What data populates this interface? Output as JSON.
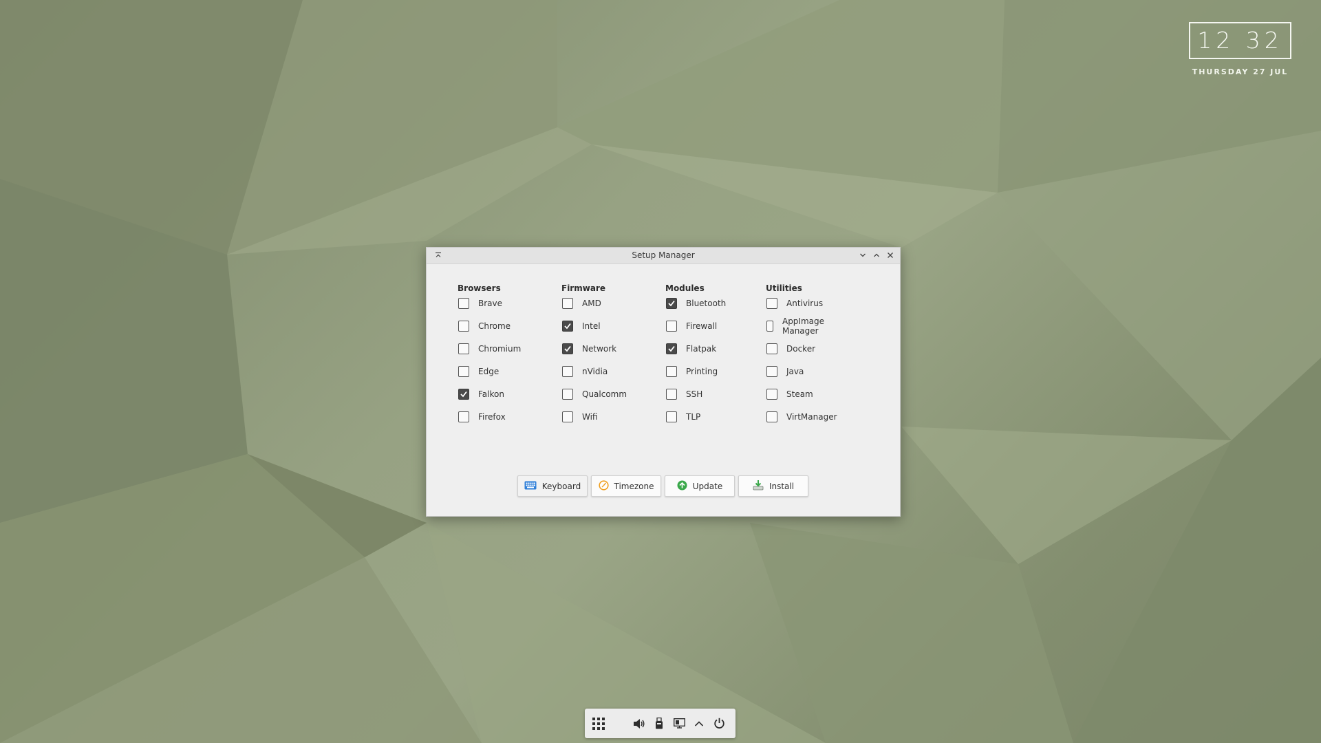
{
  "clock": {
    "time": "12 32",
    "date": "THURSDAY 27 JUL"
  },
  "window": {
    "title": "Setup Manager",
    "columns": [
      {
        "heading": "Browsers",
        "items": [
          {
            "label": "Brave",
            "checked": false
          },
          {
            "label": "Chrome",
            "checked": false
          },
          {
            "label": "Chromium",
            "checked": false
          },
          {
            "label": "Edge",
            "checked": false
          },
          {
            "label": "Falkon",
            "checked": true
          },
          {
            "label": "Firefox",
            "checked": false
          }
        ]
      },
      {
        "heading": "Firmware",
        "items": [
          {
            "label": "AMD",
            "checked": false
          },
          {
            "label": "Intel",
            "checked": true
          },
          {
            "label": "Network",
            "checked": true
          },
          {
            "label": "nVidia",
            "checked": false
          },
          {
            "label": "Qualcomm",
            "checked": false
          },
          {
            "label": "Wifi",
            "checked": false
          }
        ]
      },
      {
        "heading": "Modules",
        "items": [
          {
            "label": "Bluetooth",
            "checked": true
          },
          {
            "label": "Firewall",
            "checked": false
          },
          {
            "label": "Flatpak",
            "checked": true
          },
          {
            "label": "Printing",
            "checked": false
          },
          {
            "label": "SSH",
            "checked": false
          },
          {
            "label": "TLP",
            "checked": false
          }
        ]
      },
      {
        "heading": "Utilities",
        "items": [
          {
            "label": "Antivirus",
            "checked": false
          },
          {
            "label": "AppImage Manager",
            "checked": false
          },
          {
            "label": "Docker",
            "checked": false
          },
          {
            "label": "Java",
            "checked": false
          },
          {
            "label": "Steam",
            "checked": false
          },
          {
            "label": "VirtManager",
            "checked": false
          }
        ]
      }
    ],
    "buttons": [
      {
        "label": "Keyboard",
        "icon": "keyboard-icon"
      },
      {
        "label": "Timezone",
        "icon": "clock-icon"
      },
      {
        "label": "Update",
        "icon": "update-arrow-icon"
      },
      {
        "label": "Install",
        "icon": "install-icon"
      }
    ]
  },
  "taskbar": {
    "items": [
      "app-grid-icon",
      "volume-icon",
      "usb-drive-icon",
      "display-icon",
      "chevron-up-icon",
      "power-icon"
    ]
  },
  "colors": {
    "wallpaper": "#8b9677",
    "window_bg": "#efefef",
    "checkbox_checked": "#4a4a4a",
    "keyboard_icon": "#2f7fd8",
    "timezone_icon": "#f0a020",
    "update_icon": "#3aa84a",
    "install_icon": "#3aa84a"
  }
}
